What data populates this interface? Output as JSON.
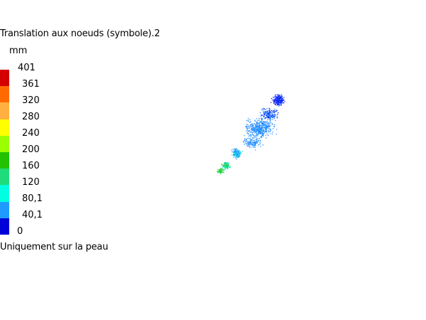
{
  "legend": {
    "title": "Translation aux noeuds (symbole).2",
    "unit": "mm",
    "colors": [
      "#d40000",
      "#ff6a00",
      "#ffb040",
      "#ffff00",
      "#9bff00",
      "#22c200",
      "#1fdc7a",
      "#00ffe0",
      "#1f9bff",
      "#0000d8"
    ],
    "ticks": [
      "401",
      "361",
      "320",
      "280",
      "240",
      "200",
      "160",
      "120",
      "80,1",
      "40,1",
      "0"
    ]
  },
  "footer": {
    "note": "Uniquement sur la peau"
  }
}
